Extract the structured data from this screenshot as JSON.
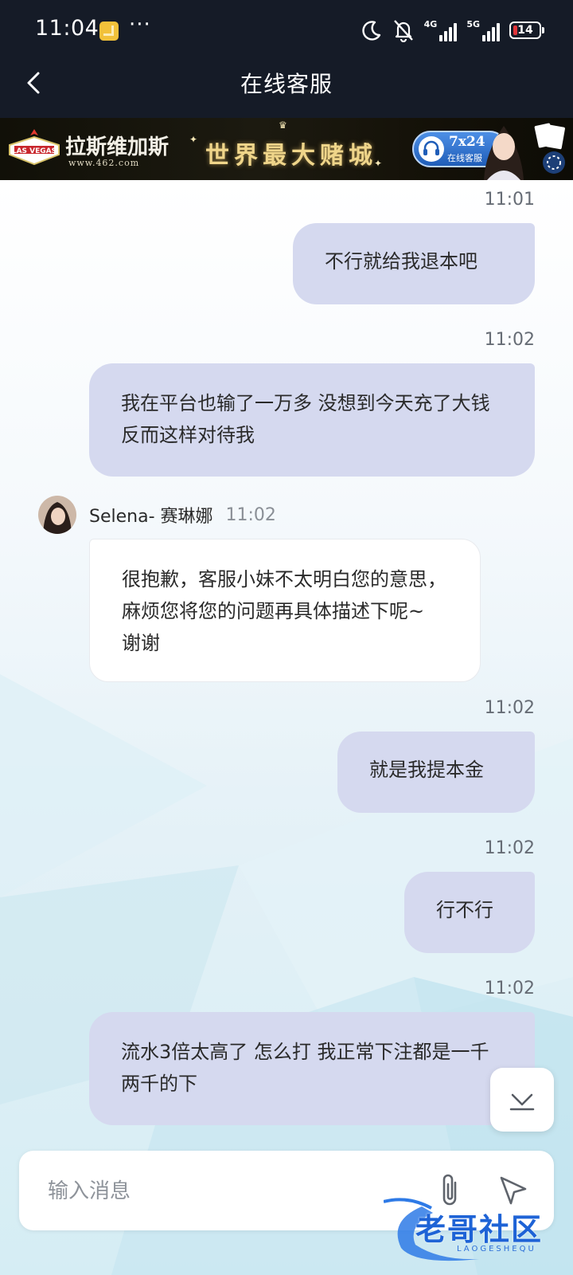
{
  "status_bar": {
    "time": "11:04",
    "more": "···",
    "network_1": "4G",
    "network_2": "5G",
    "battery": "14"
  },
  "header": {
    "title": "在线客服"
  },
  "ad_banner": {
    "brand": "拉斯维加斯",
    "url": "www.462.com",
    "sign_text": "LAS VEGAS",
    "slogan": "世界最大赌城",
    "badge_top": "7x24",
    "badge_text": "在线客服"
  },
  "messages": [
    {
      "side": "right",
      "time": "11:01",
      "text": "不行就给我退本吧"
    },
    {
      "side": "right",
      "time": "11:02",
      "text": "我在平台也输了一万多 没想到今天充了大钱反而这样对待我"
    },
    {
      "side": "left",
      "sender": "Selena- 赛琳娜",
      "time": "11:02",
      "text": "很抱歉，客服小妹不太明白您的意思，麻烦您将您的问题再具体描述下呢~ 谢谢"
    },
    {
      "side": "right",
      "time": "11:02",
      "text": "就是我提本金"
    },
    {
      "side": "right",
      "time": "11:02",
      "text": "行不行"
    },
    {
      "side": "right",
      "time": "11:02",
      "text": "流水3倍太高了 怎么打 我正常下注都是一千两千的下"
    }
  ],
  "input": {
    "placeholder": "输入消息"
  },
  "watermark": {
    "text": "老哥社区",
    "sub": "LAOGESHEQU"
  },
  "icons": {
    "back": "chevron-left-icon",
    "attach": "paperclip-icon",
    "send": "send-icon",
    "scroll_down": "scroll-to-bottom-icon",
    "moon": "moon-icon",
    "bell_off": "bell-off-icon"
  },
  "colors": {
    "header_bg": "#151b27",
    "bubble_right": "#d5d9ef",
    "bubble_left": "#ffffff",
    "battery_low": "#e0353a"
  }
}
